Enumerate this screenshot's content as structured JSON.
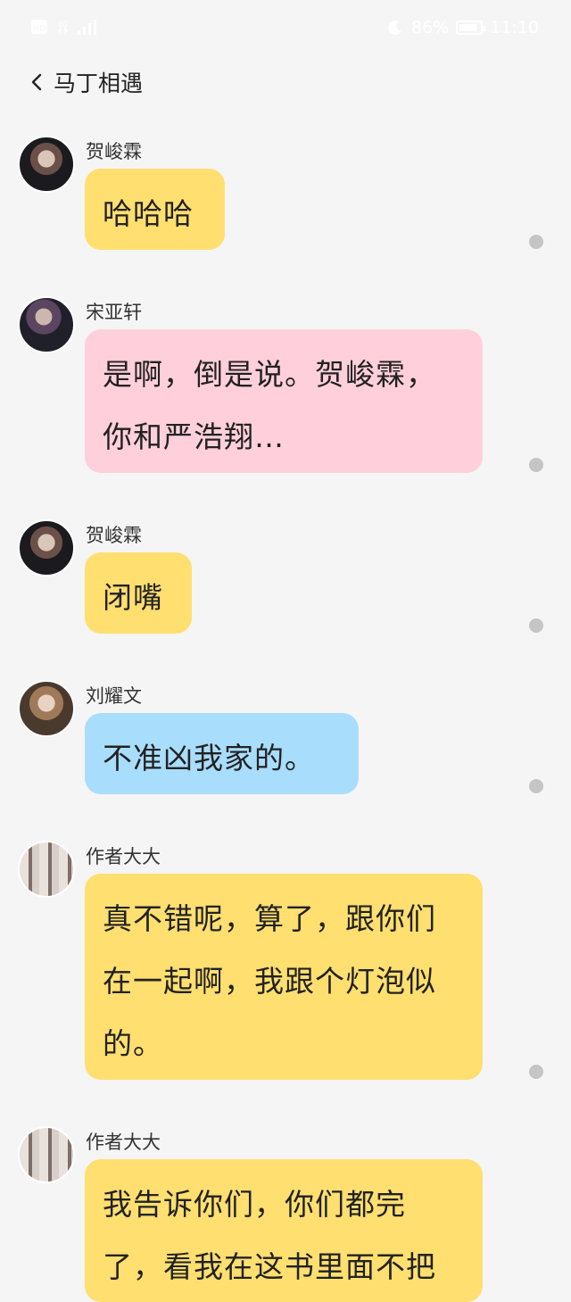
{
  "status_bar": {
    "left_icons": [
      "hd-icon",
      "4g-icon",
      "signal-icon"
    ],
    "battery_percent": "86%",
    "battery_level": 0.86,
    "time": "11:10",
    "right_icons": [
      "moon-icon",
      "battery-icon"
    ]
  },
  "header": {
    "back_icon": "chevron-left-icon",
    "title": "马丁相遇"
  },
  "colors": {
    "background": "#f5f5f5",
    "yellow_bubble": "#ffdf70",
    "pink_bubble": "#ffd0dc",
    "blue_bubble": "#a9ddfc",
    "status_dot": "#c5c5c5"
  },
  "messages": [
    {
      "sender": "贺峻霖",
      "text": "哈哈哈",
      "bubble_color": "yellow"
    },
    {
      "sender": "宋亚轩",
      "text": "是啊，倒是说。贺峻霖，你和严浩翔…",
      "bubble_color": "pink"
    },
    {
      "sender": "贺峻霖",
      "text": "闭嘴",
      "bubble_color": "yellow"
    },
    {
      "sender": "刘耀文",
      "text": "不准凶我家的。",
      "bubble_color": "blue"
    },
    {
      "sender": "作者大大",
      "text": "真不错呢，算了，跟你们在一起啊，我跟个灯泡似的。",
      "bubble_color": "yellow"
    },
    {
      "sender": "作者大大",
      "text": "我告诉你们，你们都完了，看我在这书里面不把",
      "bubble_color": "yellow"
    }
  ]
}
